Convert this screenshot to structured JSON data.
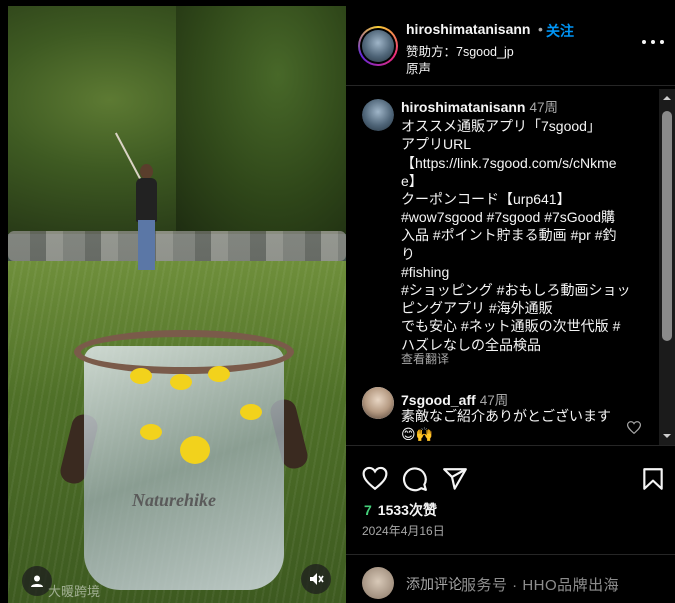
{
  "post": {
    "username": "hiroshimatanisann",
    "dot": "•",
    "follow_label": "关注",
    "sponsored": "赞助方：7sgood_jp",
    "audio": "原声",
    "caption_time": "47周",
    "caption_lines": [
      "オススメ通販アプリ「7sgood」",
      "アプリURL",
      "【https://link.7sgood.com/s/cNkme",
      "e】",
      "クーポンコード【urp641】",
      "#wow7sgood #7sgood #7sGood購",
      "入品 #ポイント貯まる動画 #pr #釣",
      "り",
      "#fishing",
      "#ショッピング #おもしろ動画ショッ",
      "ピングアプリ #海外通販",
      "でも安心 #ネット通販の次世代版 #",
      "ハズレなしの全品検品"
    ],
    "translate_label": "查看翻译",
    "reply": {
      "username": "7sgood_aff",
      "time": "47周",
      "text": "素敵なご紹介ありがとございます😊🙌"
    },
    "likes_icon": "7",
    "likes": "1533次赞",
    "date": "2024年4月16日",
    "add_comment_placeholder": "添加评论",
    "watermark": "服务号 · HHO品牌出海"
  },
  "media": {
    "brand_text": "Naturehike",
    "watermark_left": "大暖跨境"
  },
  "colors": {
    "accent": "#0095f6",
    "background": "#000000",
    "text": "#f5f5f5",
    "muted": "#a8a8a8",
    "likes_icon": "#45d07a"
  },
  "icons": [
    "more-icon",
    "heart-icon",
    "comment-icon",
    "share-icon",
    "bookmark-icon",
    "mute-icon",
    "user-tag-icon",
    "small-heart-icon"
  ]
}
